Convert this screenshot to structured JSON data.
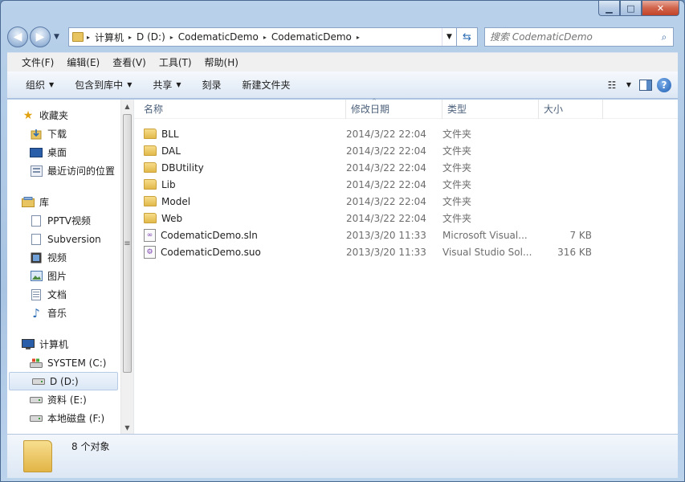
{
  "caption": {
    "minimize": "▁",
    "maximize": "□",
    "close": "✕"
  },
  "nav": {
    "back": "◀",
    "forward": "▶",
    "dropdown": "▼"
  },
  "address": {
    "crumbs": [
      "计算机",
      "D (D:)",
      "CodematicDemo",
      "CodematicDemo"
    ],
    "separator": "▸",
    "drop": "▼",
    "refresh": "⇆"
  },
  "search": {
    "placeholder": "搜索 CodematicDemo",
    "icon": "⌕"
  },
  "menu": [
    "文件(F)",
    "编辑(E)",
    "查看(V)",
    "工具(T)",
    "帮助(H)"
  ],
  "commands": [
    {
      "label": "组织",
      "arrow": "▼"
    },
    {
      "label": "包含到库中",
      "arrow": "▼"
    },
    {
      "label": "共享",
      "arrow": "▼"
    },
    {
      "label": "刻录",
      "arrow": ""
    },
    {
      "label": "新建文件夹",
      "arrow": ""
    }
  ],
  "view": {
    "view_icon": "☷",
    "view_arrow": "▼",
    "help": "?"
  },
  "sidebar": {
    "favorites": {
      "title": "收藏夹",
      "items": [
        "下载",
        "桌面",
        "最近访问的位置"
      ]
    },
    "libraries": {
      "title": "库",
      "items": [
        "PPTV视频",
        "Subversion",
        "视频",
        "图片",
        "文档",
        "音乐"
      ]
    },
    "computer": {
      "title": "计算机",
      "items": [
        "SYSTEM (C:)",
        "D (D:)",
        "资料 (E:)",
        "本地磁盘 (F:)"
      ]
    },
    "scroll": {
      "up": "▲",
      "down": "▼",
      "grip": "≡"
    }
  },
  "columns": {
    "name": "名称",
    "date": "修改日期",
    "type": "类型",
    "size": "大小",
    "sort": "^"
  },
  "files": [
    {
      "name": "BLL",
      "date": "2014/3/22 22:04",
      "type": "文件夹",
      "size": "",
      "kind": "folder"
    },
    {
      "name": "DAL",
      "date": "2014/3/22 22:04",
      "type": "文件夹",
      "size": "",
      "kind": "folder"
    },
    {
      "name": "DBUtility",
      "date": "2014/3/22 22:04",
      "type": "文件夹",
      "size": "",
      "kind": "folder"
    },
    {
      "name": "Lib",
      "date": "2014/3/22 22:04",
      "type": "文件夹",
      "size": "",
      "kind": "folder"
    },
    {
      "name": "Model",
      "date": "2014/3/22 22:04",
      "type": "文件夹",
      "size": "",
      "kind": "folder"
    },
    {
      "name": "Web",
      "date": "2014/3/22 22:04",
      "type": "文件夹",
      "size": "",
      "kind": "folder"
    },
    {
      "name": "CodematicDemo.sln",
      "date": "2013/3/20 11:33",
      "type": "Microsoft Visual...",
      "size": "7 KB",
      "kind": "sln"
    },
    {
      "name": "CodematicDemo.suo",
      "date": "2013/3/20 11:33",
      "type": "Visual Studio Sol...",
      "size": "316 KB",
      "kind": "suo"
    }
  ],
  "status": {
    "count": "8 个对象"
  }
}
